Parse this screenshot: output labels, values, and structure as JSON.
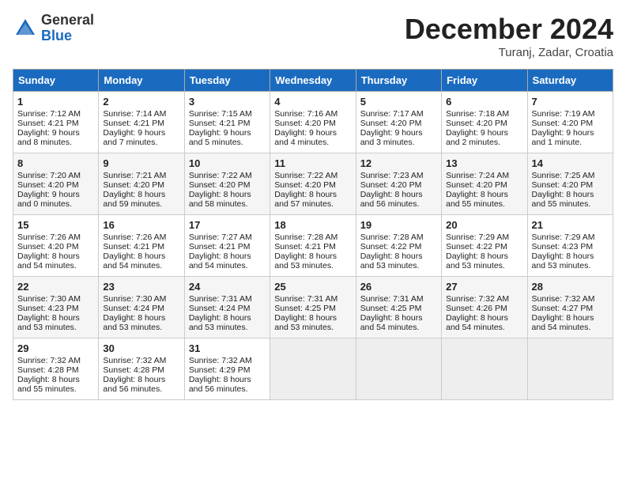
{
  "header": {
    "logo_general": "General",
    "logo_blue": "Blue",
    "month_title": "December 2024",
    "subtitle": "Turanj, Zadar, Croatia"
  },
  "days_of_week": [
    "Sunday",
    "Monday",
    "Tuesday",
    "Wednesday",
    "Thursday",
    "Friday",
    "Saturday"
  ],
  "weeks": [
    [
      {
        "day": "1",
        "lines": [
          "Sunrise: 7:12 AM",
          "Sunset: 4:21 PM",
          "Daylight: 9 hours",
          "and 8 minutes."
        ]
      },
      {
        "day": "2",
        "lines": [
          "Sunrise: 7:14 AM",
          "Sunset: 4:21 PM",
          "Daylight: 9 hours",
          "and 7 minutes."
        ]
      },
      {
        "day": "3",
        "lines": [
          "Sunrise: 7:15 AM",
          "Sunset: 4:21 PM",
          "Daylight: 9 hours",
          "and 5 minutes."
        ]
      },
      {
        "day": "4",
        "lines": [
          "Sunrise: 7:16 AM",
          "Sunset: 4:20 PM",
          "Daylight: 9 hours",
          "and 4 minutes."
        ]
      },
      {
        "day": "5",
        "lines": [
          "Sunrise: 7:17 AM",
          "Sunset: 4:20 PM",
          "Daylight: 9 hours",
          "and 3 minutes."
        ]
      },
      {
        "day": "6",
        "lines": [
          "Sunrise: 7:18 AM",
          "Sunset: 4:20 PM",
          "Daylight: 9 hours",
          "and 2 minutes."
        ]
      },
      {
        "day": "7",
        "lines": [
          "Sunrise: 7:19 AM",
          "Sunset: 4:20 PM",
          "Daylight: 9 hours",
          "and 1 minute."
        ]
      }
    ],
    [
      {
        "day": "8",
        "lines": [
          "Sunrise: 7:20 AM",
          "Sunset: 4:20 PM",
          "Daylight: 9 hours",
          "and 0 minutes."
        ]
      },
      {
        "day": "9",
        "lines": [
          "Sunrise: 7:21 AM",
          "Sunset: 4:20 PM",
          "Daylight: 8 hours",
          "and 59 minutes."
        ]
      },
      {
        "day": "10",
        "lines": [
          "Sunrise: 7:22 AM",
          "Sunset: 4:20 PM",
          "Daylight: 8 hours",
          "and 58 minutes."
        ]
      },
      {
        "day": "11",
        "lines": [
          "Sunrise: 7:22 AM",
          "Sunset: 4:20 PM",
          "Daylight: 8 hours",
          "and 57 minutes."
        ]
      },
      {
        "day": "12",
        "lines": [
          "Sunrise: 7:23 AM",
          "Sunset: 4:20 PM",
          "Daylight: 8 hours",
          "and 56 minutes."
        ]
      },
      {
        "day": "13",
        "lines": [
          "Sunrise: 7:24 AM",
          "Sunset: 4:20 PM",
          "Daylight: 8 hours",
          "and 55 minutes."
        ]
      },
      {
        "day": "14",
        "lines": [
          "Sunrise: 7:25 AM",
          "Sunset: 4:20 PM",
          "Daylight: 8 hours",
          "and 55 minutes."
        ]
      }
    ],
    [
      {
        "day": "15",
        "lines": [
          "Sunrise: 7:26 AM",
          "Sunset: 4:20 PM",
          "Daylight: 8 hours",
          "and 54 minutes."
        ]
      },
      {
        "day": "16",
        "lines": [
          "Sunrise: 7:26 AM",
          "Sunset: 4:21 PM",
          "Daylight: 8 hours",
          "and 54 minutes."
        ]
      },
      {
        "day": "17",
        "lines": [
          "Sunrise: 7:27 AM",
          "Sunset: 4:21 PM",
          "Daylight: 8 hours",
          "and 54 minutes."
        ]
      },
      {
        "day": "18",
        "lines": [
          "Sunrise: 7:28 AM",
          "Sunset: 4:21 PM",
          "Daylight: 8 hours",
          "and 53 minutes."
        ]
      },
      {
        "day": "19",
        "lines": [
          "Sunrise: 7:28 AM",
          "Sunset: 4:22 PM",
          "Daylight: 8 hours",
          "and 53 minutes."
        ]
      },
      {
        "day": "20",
        "lines": [
          "Sunrise: 7:29 AM",
          "Sunset: 4:22 PM",
          "Daylight: 8 hours",
          "and 53 minutes."
        ]
      },
      {
        "day": "21",
        "lines": [
          "Sunrise: 7:29 AM",
          "Sunset: 4:23 PM",
          "Daylight: 8 hours",
          "and 53 minutes."
        ]
      }
    ],
    [
      {
        "day": "22",
        "lines": [
          "Sunrise: 7:30 AM",
          "Sunset: 4:23 PM",
          "Daylight: 8 hours",
          "and 53 minutes."
        ]
      },
      {
        "day": "23",
        "lines": [
          "Sunrise: 7:30 AM",
          "Sunset: 4:24 PM",
          "Daylight: 8 hours",
          "and 53 minutes."
        ]
      },
      {
        "day": "24",
        "lines": [
          "Sunrise: 7:31 AM",
          "Sunset: 4:24 PM",
          "Daylight: 8 hours",
          "and 53 minutes."
        ]
      },
      {
        "day": "25",
        "lines": [
          "Sunrise: 7:31 AM",
          "Sunset: 4:25 PM",
          "Daylight: 8 hours",
          "and 53 minutes."
        ]
      },
      {
        "day": "26",
        "lines": [
          "Sunrise: 7:31 AM",
          "Sunset: 4:25 PM",
          "Daylight: 8 hours",
          "and 54 minutes."
        ]
      },
      {
        "day": "27",
        "lines": [
          "Sunrise: 7:32 AM",
          "Sunset: 4:26 PM",
          "Daylight: 8 hours",
          "and 54 minutes."
        ]
      },
      {
        "day": "28",
        "lines": [
          "Sunrise: 7:32 AM",
          "Sunset: 4:27 PM",
          "Daylight: 8 hours",
          "and 54 minutes."
        ]
      }
    ],
    [
      {
        "day": "29",
        "lines": [
          "Sunrise: 7:32 AM",
          "Sunset: 4:28 PM",
          "Daylight: 8 hours",
          "and 55 minutes."
        ]
      },
      {
        "day": "30",
        "lines": [
          "Sunrise: 7:32 AM",
          "Sunset: 4:28 PM",
          "Daylight: 8 hours",
          "and 56 minutes."
        ]
      },
      {
        "day": "31",
        "lines": [
          "Sunrise: 7:32 AM",
          "Sunset: 4:29 PM",
          "Daylight: 8 hours",
          "and 56 minutes."
        ]
      },
      null,
      null,
      null,
      null
    ]
  ]
}
